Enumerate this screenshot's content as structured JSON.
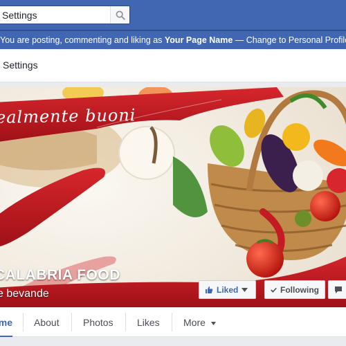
{
  "topbar": {
    "search": {
      "value": "Settings",
      "placeholder": "Search"
    },
    "brand_color": "#4267b2"
  },
  "posting_bar": {
    "prefix": "You are posting, commenting and liking as ",
    "page_name": "Your Page Name",
    "suffix": " — Change to Personal Profile"
  },
  "settings_bar": {
    "label": "Settings"
  },
  "cover": {
    "tagline": "ealmente buoni",
    "page_name": "CALABRIA FOOD",
    "category": "e bevande",
    "accent_color": "#c41a22"
  },
  "actions": {
    "liked_label": "Liked",
    "following_label": "Following",
    "message_label": "Message"
  },
  "tabs": [
    {
      "label": "Home",
      "active": true
    },
    {
      "label": "About",
      "active": false
    },
    {
      "label": "Photos",
      "active": false
    },
    {
      "label": "Likes",
      "active": false
    },
    {
      "label": "More",
      "active": false
    }
  ]
}
